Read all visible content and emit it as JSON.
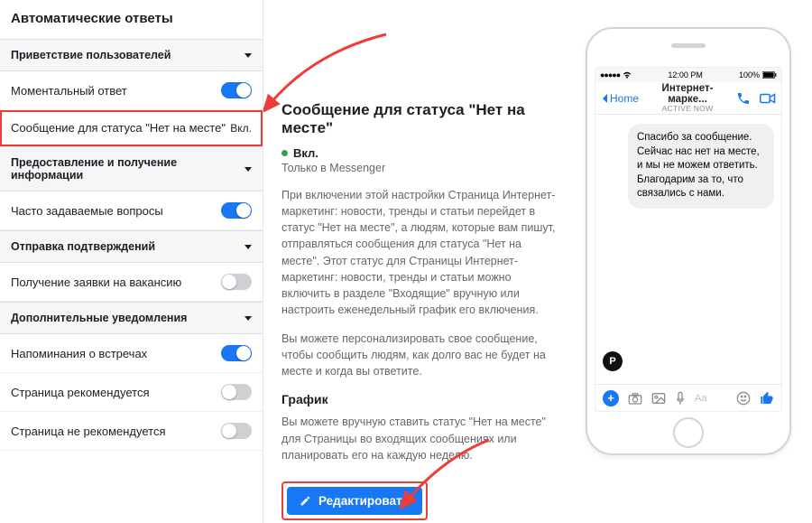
{
  "sidebar": {
    "title": "Автоматические ответы",
    "sections": [
      {
        "label": "Приветствие пользователей",
        "rows": [
          {
            "label": "Моментальный ответ",
            "toggle": "on"
          },
          {
            "label": "Сообщение для статуса \"Нет на месте\"",
            "status_text": "Вкл.",
            "selected": true
          }
        ]
      },
      {
        "label": "Предоставление и получение информации",
        "rows": [
          {
            "label": "Часто задаваемые вопросы",
            "toggle": "on"
          }
        ]
      },
      {
        "label": "Отправка подтверждений",
        "rows": [
          {
            "label": "Получение заявки на вакансию",
            "toggle": "off"
          }
        ]
      },
      {
        "label": "Дополнительные уведомления",
        "rows": [
          {
            "label": "Напоминания о встречах",
            "toggle": "on"
          },
          {
            "label": "Страница рекомендуется",
            "toggle": "off"
          },
          {
            "label": "Страница не рекомендуется",
            "toggle": "off"
          }
        ]
      }
    ]
  },
  "center": {
    "heading": "Сообщение для статуса \"Нет на месте\"",
    "state": "Вкл.",
    "platform_note": "Только в Messenger",
    "para1": "При включении этой настройки Страница Интернет-маркетинг: новости, тренды и статьи перейдет в статус \"Нет на месте\", а людям, которые вам пишут, отправляться сообщения для статуса \"Нет на месте\". Этот статус для Страницы Интернет-маркетинг: новости, тренды и статьи можно включить в разделе \"Входящие\" вручную или настроить еженедельный график его включения.",
    "para2": "Вы можете персонализировать свое сообщение, чтобы сообщить людям, как долго вас не будет на месте и когда вы ответите.",
    "schedule_heading": "График",
    "para3": "Вы можете вручную ставить статус \"Нет на месте\" для Страницы во входящих сообщениях или планировать его на каждую неделю.",
    "edit_button": "Редактировать"
  },
  "phone": {
    "statusbar": {
      "carrier_dots": "●●●●●",
      "wifi": "wifi",
      "time": "12:00 PM",
      "battery_text": "100%"
    },
    "nav": {
      "back": "Home",
      "title": "Интернет-марке...",
      "subtitle": "active now"
    },
    "message": "Спасибо за сообщение. Сейчас нас нет на месте, и мы не можем ответить. Благодарим за то, что связались с нами.",
    "composer_placeholder": "Aa",
    "avatar_letter": "P"
  }
}
